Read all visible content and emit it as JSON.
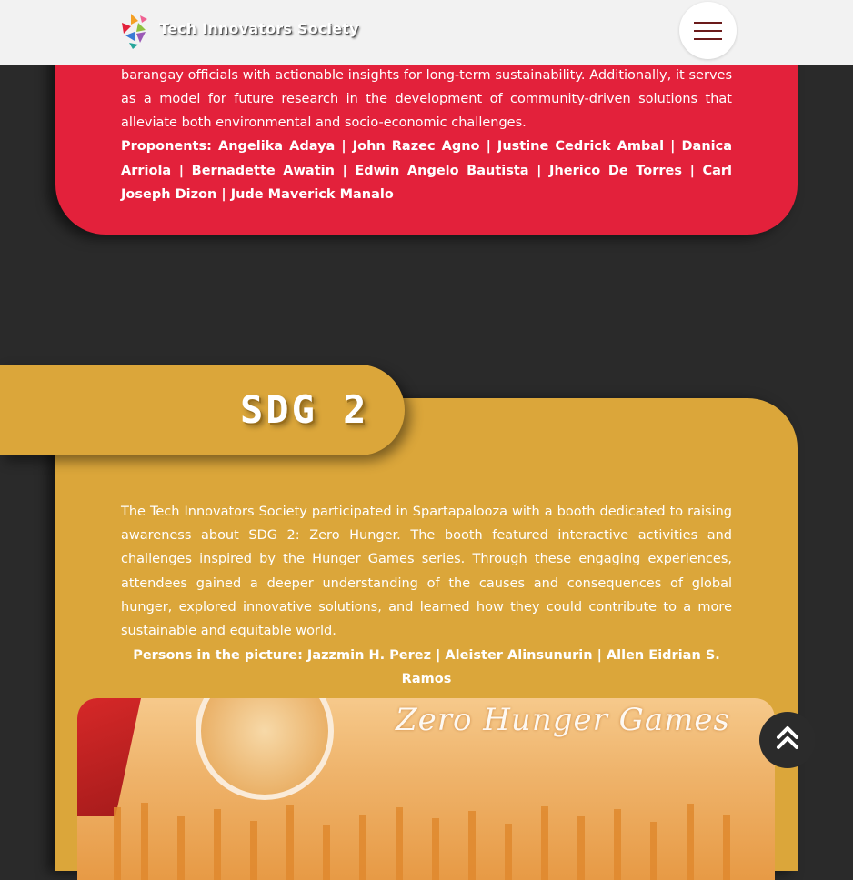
{
  "header": {
    "brand": "Tech Innovators Society",
    "menu_icon": "hamburger-menu-icon"
  },
  "red_card": {
    "paragraph": "barangay officials with actionable insights for long-term sustainability. Additionally, it serves as a model for future research in the development of community-driven solutions that alleviate both environmental and socio-economic challenges.",
    "proponents": "Proponents: Angelika Adaya | John Razec Agno | Justine Cedrick Ambal | Danica Arriola | Bernadette Awatin | Edwin Angelo Bautista | Jherico De Torres | Carl Joseph Dizon | Jude Maverick Manalo"
  },
  "sdg2": {
    "title": "SDG 2",
    "paragraph": "The Tech Innovators Society participated in Spartapalooza with a booth dedicated to raising awareness about SDG 2: Zero Hunger. The booth featured interactive activities and challenges inspired by the Hunger Games series. Through these engaging experiences, attendees gained a deeper understanding of the causes and consequences of global hunger, explored innovative solutions, and learned how they could contribute to a more sustainable and equitable world.",
    "persons": "Persons in the picture: Jazzmin H. Perez | Aleister Alinsunurin | Allen Eidrian S. Ramos",
    "photo_banner": "Zero Hunger Games"
  },
  "scroll_top": {
    "icon": "double-chevron-up-icon"
  },
  "colors": {
    "header_bg": "#f2f2f2",
    "page_bg": "#2a2a2a",
    "red_card": "#e3213b",
    "yellow_card": "#dba63a",
    "menu_lines": "#6b1a1a"
  }
}
